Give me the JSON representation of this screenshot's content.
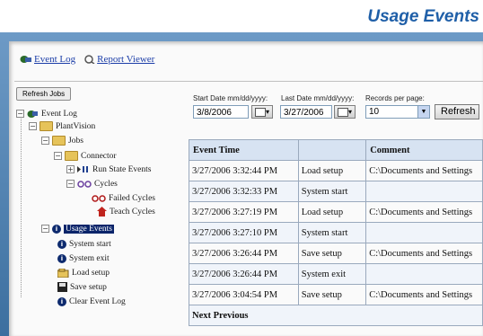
{
  "page": {
    "title": "Usage Events"
  },
  "top_links": {
    "event_log": "Event Log",
    "report_viewer": "Report Viewer"
  },
  "tree": {
    "refresh_jobs": "Refresh Jobs",
    "items": [
      {
        "label": "Event Log"
      },
      {
        "label": "PlantVision"
      },
      {
        "label": "Jobs"
      },
      {
        "label": "Connector"
      },
      {
        "label": "Run State Events"
      },
      {
        "label": "Cycles"
      },
      {
        "label": "Failed Cycles"
      },
      {
        "label": "Teach Cycles"
      },
      {
        "label": "Usage Events"
      },
      {
        "label": "System start"
      },
      {
        "label": "System exit"
      },
      {
        "label": "Load setup"
      },
      {
        "label": "Save setup"
      },
      {
        "label": "Clear Event Log"
      }
    ]
  },
  "controls": {
    "start_label": "Start Date mm/dd/yyyy:",
    "start_value": "3/8/2006",
    "last_label": "Last Date mm/dd/yyyy:",
    "last_value": "3/27/2006",
    "records_label": "Records per page:",
    "records_value": "10",
    "refresh_label": "Refresh"
  },
  "table": {
    "headers": [
      "Event Time",
      "",
      "Comment"
    ],
    "rows": [
      [
        "3/27/2006 3:32:44 PM",
        "Load setup",
        "C:\\Documents and Settings"
      ],
      [
        "3/27/2006 3:32:33 PM",
        "System start",
        ""
      ],
      [
        "3/27/2006 3:27:19 PM",
        "Load setup",
        "C:\\Documents and Settings"
      ],
      [
        "3/27/2006 3:27:10 PM",
        "System start",
        ""
      ],
      [
        "3/27/2006 3:26:44 PM",
        "Save setup",
        "C:\\Documents and Settings"
      ],
      [
        "3/27/2006 3:26:44 PM",
        "System exit",
        ""
      ],
      [
        "3/27/2006 3:04:54 PM",
        "Save setup",
        "C:\\Documents and Settings"
      ]
    ],
    "nav_next": "Next",
    "nav_previous": "Previous"
  },
  "colors": {
    "title": "#1f5fa8",
    "frame": "#4f80b0",
    "header_bg": "#d7e3f2",
    "selection": "#0a246a"
  },
  "icons": [
    "event-log-icon",
    "report-viewer-icon",
    "folder-icon",
    "info-icon",
    "pause-icon",
    "cycles-icon",
    "failed-cycles-icon",
    "teach-cycles-icon",
    "load-setup-icon",
    "save-setup-icon",
    "calendar-icon",
    "dropdown-arrow-icon"
  ]
}
